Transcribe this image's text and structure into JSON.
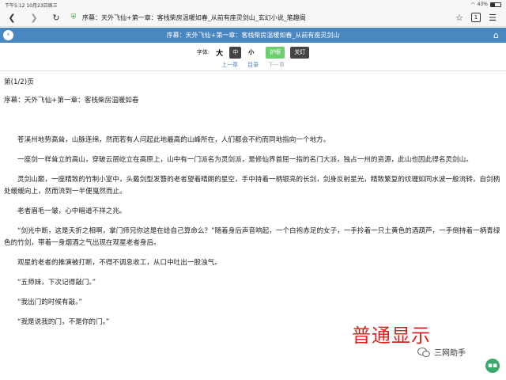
{
  "status_bar": {
    "time": "下午5:12",
    "date": "10月23日周三",
    "battery": "43%",
    "battery_level": 0.43
  },
  "browser": {
    "page_title": "序幕：天外飞仙+第一章：客栈柴房温暖如春_从前有座灵剑山_玄幻小说_笔趣阁",
    "tab_count": "1"
  },
  "site_header": {
    "title": "序幕：天外飞仙+第一章：客栈柴房温暖如春_从前有座灵剑山"
  },
  "font_controls": {
    "label": "字体:",
    "large": "大",
    "medium": "中",
    "small": "小",
    "eye_care": "护眼",
    "lights_off": "关灯"
  },
  "chapter_nav": {
    "prev": "上一章",
    "toc": "目录",
    "next": "下一章"
  },
  "content": {
    "page_label": "第(1/2)页",
    "chapter_title": "序幕：天外飞仙+第一章：客栈柴房温暖如春",
    "paragraphs": [
      "苍溪州地势高耸，山脉连绵，然而若有人问起此地最高的山峰所在，人们都会不约而同地指向一个地方。",
      "一座剑一样耸立的高山，穿破云层屹立在高原上，山中有一门派名为灵剑派，是修仙界首屈一指的名门大派，独占一州的资源，此山也因此得名灵剑山。",
      "灵剑山巅，一座精致的竹制小室中，头戴剑型发簪的老者望着晴朗的星空，手中持着一柄银亮的长剑，剑身反射星光，精致繁复的纹理如同水波一般流转，自剑柄处缓缓向上，然而流到一半便戛然而止。",
      "老者眉毛一皱，心中暗道不祥之兆。",
      "“剑光中断，这是夭折之相啊，掌门师兄你这是在给自己算命么？”随着身后声音响起，一个白袍赤足的女子，一手拎着一只土黄色的酒葫芦，一手倒持着一柄青绿色的竹剑，带着一身烟酒之气出现在观星老者身后。",
      "观星的老者的推演被打断，不得不调息收工，从口中吐出一股浊气。",
      "“五师妹，下次记得敲门。”",
      "“我出门的时候有敲。”",
      "“我是说我的门，不是你的门。”"
    ]
  },
  "overlay": {
    "label": "普通显示",
    "watermark": "三网助手"
  }
}
